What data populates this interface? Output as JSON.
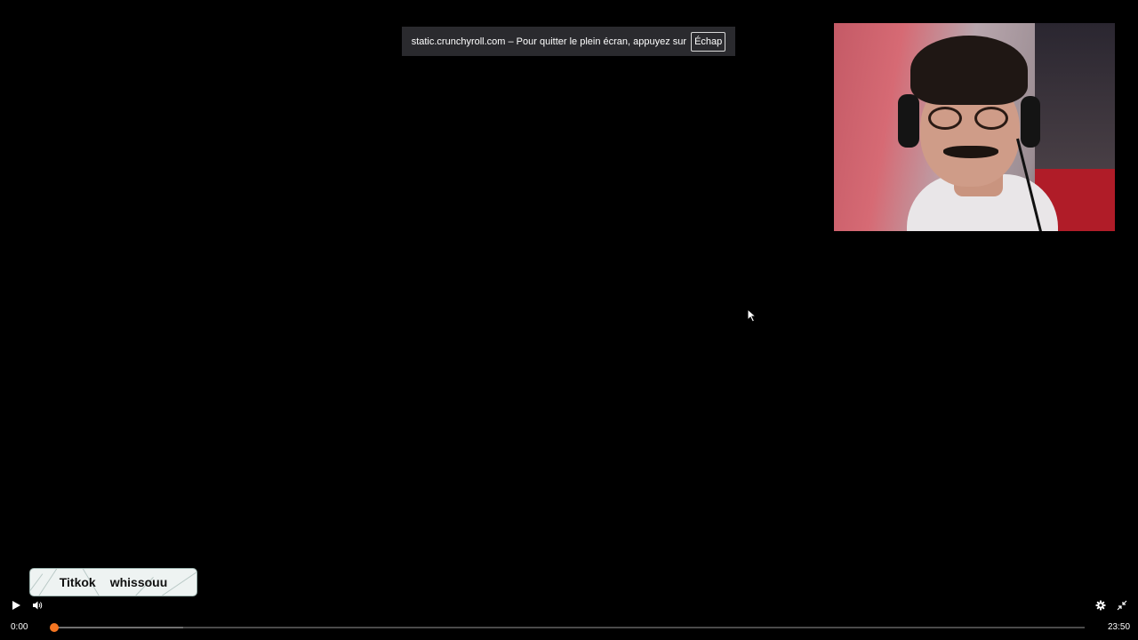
{
  "fullscreen_notice": {
    "message": "static.crunchyroll.com – Pour quitter le plein écran, appuyez sur",
    "key": "Échap"
  },
  "badge": {
    "left_text": "Titkok",
    "right_text": "whissouu"
  },
  "controls": {
    "current_time": "0:00",
    "duration": "23:50",
    "progress": 0.0,
    "buffered": 0.126,
    "accent_color": "#f47521"
  },
  "icons": {
    "play": "play-icon",
    "volume": "volume-icon",
    "settings": "gear-icon",
    "exit_fullscreen": "exit-fullscreen-icon"
  }
}
